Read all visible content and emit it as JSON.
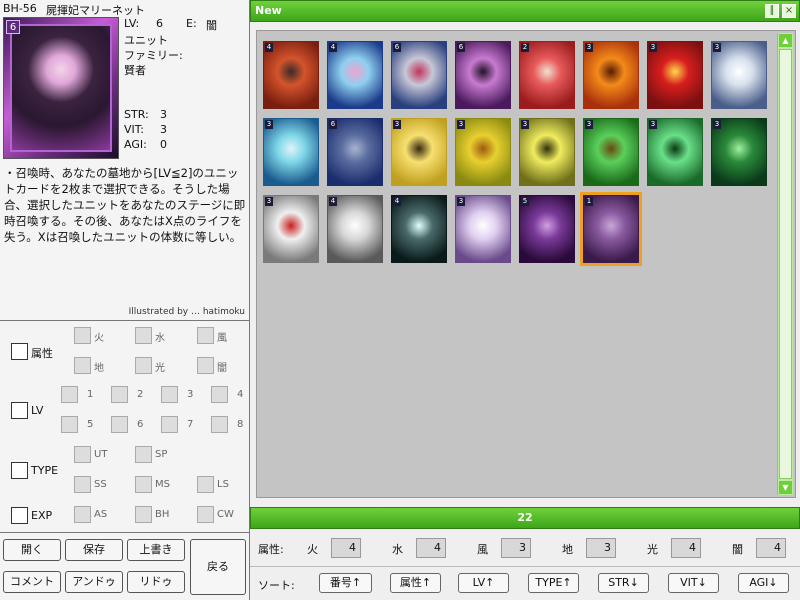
{
  "card": {
    "id": "BH-56",
    "name": "屍揮妃マリーネット",
    "lv_label": "LV:",
    "lv": "6",
    "element_label": "E:",
    "element": "闇",
    "type": "ユニット",
    "family_label": "ファミリー:",
    "family": "賢者",
    "str_label": "STR:",
    "str": "3",
    "vit_label": "VIT:",
    "vit": "3",
    "agi_label": "AGI:",
    "agi": "0",
    "level_badge": "6",
    "text": "・召喚時、あなたの墓地から[LV≦2]のユニットカードを2枚まで選択できる。そうした場合、選択したユニットをあなたのステージに即時召喚する。その後、あなたはX点のライフを失う。Xは召喚したユニットの体数に等しい。",
    "illustrator": "Illustrated by … hatimoku"
  },
  "filters": {
    "attribute": {
      "label": "属性",
      "options": [
        "火",
        "水",
        "風",
        "地",
        "光",
        "闇"
      ]
    },
    "lv": {
      "label": "LV",
      "options": [
        "1",
        "2",
        "3",
        "4",
        "5",
        "6",
        "7",
        "8"
      ]
    },
    "type": {
      "label": "TYPE",
      "options": [
        "UT",
        "SP",
        "SS",
        "MS",
        "LS"
      ]
    },
    "exp": {
      "label": "EXP",
      "options": [
        "AS",
        "BH",
        "CW"
      ]
    }
  },
  "buttons": {
    "open": "開く",
    "save": "保存",
    "overwrite": "上書き",
    "back": "戻る",
    "comment": "コメント",
    "undo": "アンドゥ",
    "redo": "リドゥ"
  },
  "window": {
    "title": "New",
    "count": "22"
  },
  "cards": [
    {
      "lv": "4",
      "colors": [
        "#7a1e10",
        "#d4542c",
        "#3a2a2a"
      ]
    },
    {
      "lv": "4",
      "colors": [
        "#1c3a8a",
        "#8fd0ef",
        "#f0a3cf"
      ]
    },
    {
      "lv": "6",
      "colors": [
        "#2a3f7e",
        "#c7c7d6",
        "#c1345c"
      ]
    },
    {
      "lv": "6",
      "colors": [
        "#4a1a5c",
        "#c87ad0",
        "#231129"
      ]
    },
    {
      "lv": "2",
      "colors": [
        "#9a1c1c",
        "#e85a5a",
        "#f0e0d0"
      ]
    },
    {
      "lv": "3",
      "colors": [
        "#a8300c",
        "#f48a1a",
        "#5a1a06"
      ]
    },
    {
      "lv": "3",
      "colors": [
        "#7a1010",
        "#d81e1e",
        "#ffd84a"
      ]
    },
    {
      "lv": "3",
      "colors": [
        "#4a5e8a",
        "#d6e0ec",
        "#ffffff"
      ]
    },
    {
      "lv": "3",
      "colors": [
        "#1a5a8e",
        "#7fd7e8",
        "#e0f4f8"
      ]
    },
    {
      "lv": "6",
      "colors": [
        "#1c2d6e",
        "#5a6ea0",
        "#aab4d0"
      ]
    },
    {
      "lv": "3",
      "colors": [
        "#c0a020",
        "#f8e070",
        "#3a2a10"
      ]
    },
    {
      "lv": "3",
      "colors": [
        "#8a8a10",
        "#e8d030",
        "#a05a10"
      ]
    },
    {
      "lv": "3",
      "colors": [
        "#70701a",
        "#f0ec60",
        "#30300a"
      ]
    },
    {
      "lv": "3",
      "colors": [
        "#1a6a1a",
        "#5ad05a",
        "#6a4a10"
      ]
    },
    {
      "lv": "3",
      "colors": [
        "#1a6a2a",
        "#6ae08a",
        "#0a3a10"
      ]
    },
    {
      "lv": "3",
      "colors": [
        "#0a3a1a",
        "#2a8a3a",
        "#a0f0a0"
      ]
    },
    {
      "lv": "3",
      "colors": [
        "#7a7a7a",
        "#f0f0f0",
        "#c81e1e"
      ]
    },
    {
      "lv": "4",
      "colors": [
        "#5a5a5a",
        "#d8d8d8",
        "#ffffff"
      ]
    },
    {
      "lv": "4",
      "colors": [
        "#0a1a1a",
        "#4a6a6a",
        "#e0ffff"
      ]
    },
    {
      "lv": "3",
      "colors": [
        "#6a4a8a",
        "#e0d0f0",
        "#ffffff"
      ]
    },
    {
      "lv": "5",
      "colors": [
        "#2a0a3a",
        "#7a3a9a",
        "#d0a0e0"
      ]
    },
    {
      "lv": "1",
      "colors": [
        "#3a1a4a",
        "#8a5aa0",
        "#c8a8d8"
      ],
      "selected": true
    }
  ],
  "attributes": [
    {
      "label": "火",
      "count": "4"
    },
    {
      "label": "水",
      "count": "4"
    },
    {
      "label": "風",
      "count": "3"
    },
    {
      "label": "地",
      "count": "3"
    },
    {
      "label": "光",
      "count": "4"
    },
    {
      "label": "闇",
      "count": "4"
    }
  ],
  "attr_row_label": "属性:",
  "sort": {
    "label": "ソート:",
    "buttons": [
      "番号↑",
      "属性↑",
      "LV↑",
      "TYPE↑",
      "STR↓",
      "VIT↓",
      "AGI↓"
    ]
  },
  "theme": {
    "accent": "#4cbb22",
    "selected": "#f0a020"
  }
}
